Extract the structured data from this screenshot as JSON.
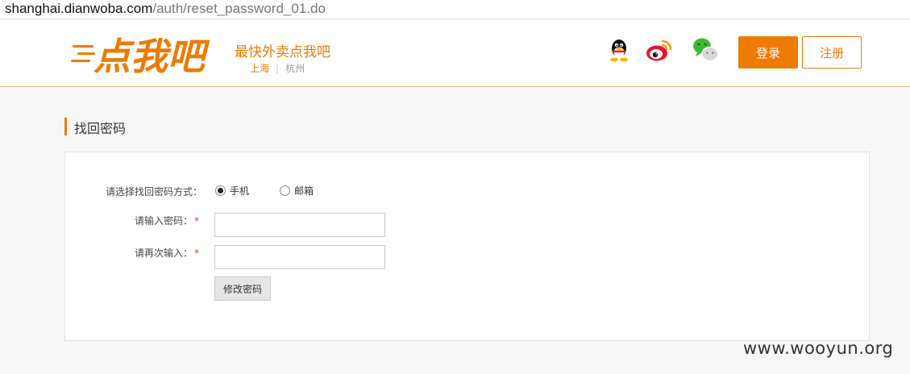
{
  "browser": {
    "url_host": "shanghai.dianwoba.com",
    "url_path": "/auth/reset_password_01.do"
  },
  "header": {
    "logo_text": "点我吧",
    "slogan": "最快外卖点我吧",
    "cities": {
      "active": "上海",
      "separator": "|",
      "other": "杭州"
    },
    "login_label": "登录",
    "register_label": "注册",
    "accent_color": "#ee7a00"
  },
  "page": {
    "title": "找回密码"
  },
  "form": {
    "method_label": "请选择找回密码方式：",
    "method_options": [
      {
        "label": "手机",
        "checked": true
      },
      {
        "label": "邮箱",
        "checked": false
      }
    ],
    "password_label": "请输入密码：",
    "confirm_label": "请再次输入：",
    "required_mark": "*",
    "password_value": "",
    "confirm_value": "",
    "submit_label": "修改密码"
  },
  "watermark": "www.wooyun.org"
}
